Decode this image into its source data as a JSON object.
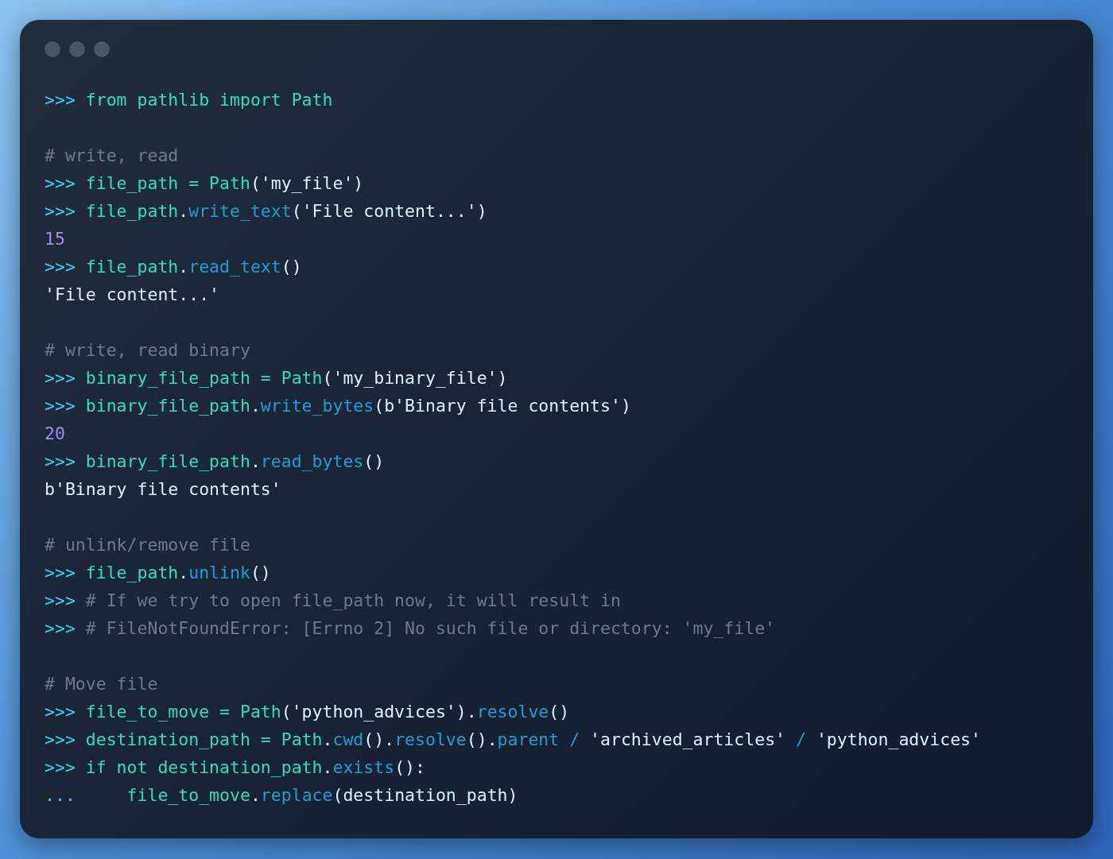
{
  "window": {
    "controls": [
      {
        "kind": "dot"
      },
      {
        "kind": "dot"
      },
      {
        "kind": "dot"
      }
    ]
  },
  "code_blocks": [
    {
      "lines": [
        {
          "tokens": [
            {
              "kind": "prompt",
              "text": ">>> "
            },
            {
              "kind": "name",
              "text": "from pathlib import Path"
            }
          ]
        }
      ]
    },
    {
      "lines": [
        {
          "tokens": [
            {
              "kind": "comment",
              "text": "# write, read"
            }
          ]
        },
        {
          "tokens": [
            {
              "kind": "prompt",
              "text": ">>> "
            },
            {
              "kind": "name",
              "text": "file_path = Path"
            },
            {
              "kind": "plain",
              "text": "('my_file')"
            }
          ]
        },
        {
          "tokens": [
            {
              "kind": "prompt",
              "text": ">>> "
            },
            {
              "kind": "name",
              "text": "file_path"
            },
            {
              "kind": "plain",
              "text": "."
            },
            {
              "kind": "method",
              "text": "write_text"
            },
            {
              "kind": "plain",
              "text": "('File content...')"
            }
          ]
        },
        {
          "tokens": [
            {
              "kind": "number",
              "text": "15"
            }
          ]
        },
        {
          "tokens": [
            {
              "kind": "prompt",
              "text": ">>> "
            },
            {
              "kind": "name",
              "text": "file_path"
            },
            {
              "kind": "plain",
              "text": "."
            },
            {
              "kind": "method",
              "text": "read_text"
            },
            {
              "kind": "plain",
              "text": "()"
            }
          ]
        },
        {
          "tokens": [
            {
              "kind": "plain",
              "text": "'File content...'"
            }
          ]
        }
      ]
    },
    {
      "lines": [
        {
          "tokens": [
            {
              "kind": "comment",
              "text": "# write, read binary"
            }
          ]
        },
        {
          "tokens": [
            {
              "kind": "prompt",
              "text": ">>> "
            },
            {
              "kind": "name",
              "text": "binary_file_path = Path"
            },
            {
              "kind": "plain",
              "text": "('my_binary_file')"
            }
          ]
        },
        {
          "tokens": [
            {
              "kind": "prompt",
              "text": ">>> "
            },
            {
              "kind": "name",
              "text": "binary_file_path"
            },
            {
              "kind": "plain",
              "text": "."
            },
            {
              "kind": "method",
              "text": "write_bytes"
            },
            {
              "kind": "plain",
              "text": "(b'Binary file contents')"
            }
          ]
        },
        {
          "tokens": [
            {
              "kind": "number",
              "text": "20"
            }
          ]
        },
        {
          "tokens": [
            {
              "kind": "prompt",
              "text": ">>> "
            },
            {
              "kind": "name",
              "text": "binary_file_path"
            },
            {
              "kind": "plain",
              "text": "."
            },
            {
              "kind": "method",
              "text": "read_bytes"
            },
            {
              "kind": "plain",
              "text": "()"
            }
          ]
        },
        {
          "tokens": [
            {
              "kind": "plain",
              "text": "b'Binary file contents'"
            }
          ]
        }
      ]
    },
    {
      "lines": [
        {
          "tokens": [
            {
              "kind": "comment",
              "text": "# unlink/remove file"
            }
          ]
        },
        {
          "tokens": [
            {
              "kind": "prompt",
              "text": ">>> "
            },
            {
              "kind": "name",
              "text": "file_path"
            },
            {
              "kind": "plain",
              "text": "."
            },
            {
              "kind": "method",
              "text": "unlink"
            },
            {
              "kind": "plain",
              "text": "()"
            }
          ]
        },
        {
          "tokens": [
            {
              "kind": "prompt",
              "text": ">>> "
            },
            {
              "kind": "comment",
              "text": "# If we try to open file_path now, it will result in"
            }
          ]
        },
        {
          "tokens": [
            {
              "kind": "prompt",
              "text": ">>> "
            },
            {
              "kind": "comment",
              "text": "# FileNotFoundError: [Errno 2] No such file or directory: 'my_file'"
            }
          ]
        }
      ]
    },
    {
      "lines": [
        {
          "tokens": [
            {
              "kind": "comment",
              "text": "# Move file"
            }
          ]
        },
        {
          "tokens": [
            {
              "kind": "prompt",
              "text": ">>> "
            },
            {
              "kind": "name",
              "text": "file_to_move = Path"
            },
            {
              "kind": "plain",
              "text": "('python_advices')."
            },
            {
              "kind": "method",
              "text": "resolve"
            },
            {
              "kind": "plain",
              "text": "()"
            }
          ]
        },
        {
          "tokens": [
            {
              "kind": "prompt",
              "text": ">>> "
            },
            {
              "kind": "name",
              "text": "destination_path = Path"
            },
            {
              "kind": "plain",
              "text": "."
            },
            {
              "kind": "method",
              "text": "cwd"
            },
            {
              "kind": "plain",
              "text": "()."
            },
            {
              "kind": "method",
              "text": "resolve"
            },
            {
              "kind": "plain",
              "text": "()."
            },
            {
              "kind": "method",
              "text": "parent / "
            },
            {
              "kind": "plain",
              "text": "'archived_articles' "
            },
            {
              "kind": "method",
              "text": "/ "
            },
            {
              "kind": "plain",
              "text": "'python_advices'"
            }
          ]
        },
        {
          "tokens": [
            {
              "kind": "prompt",
              "text": ">>> "
            },
            {
              "kind": "name",
              "text": "if not destination_path"
            },
            {
              "kind": "plain",
              "text": "."
            },
            {
              "kind": "method",
              "text": "exists"
            },
            {
              "kind": "plain",
              "text": "():"
            }
          ]
        },
        {
          "tokens": [
            {
              "kind": "prompt",
              "text": "...     "
            },
            {
              "kind": "name",
              "text": "file_to_move"
            },
            {
              "kind": "plain",
              "text": "."
            },
            {
              "kind": "method",
              "text": "replace"
            },
            {
              "kind": "plain",
              "text": "(destination_path)"
            }
          ]
        }
      ]
    }
  ]
}
